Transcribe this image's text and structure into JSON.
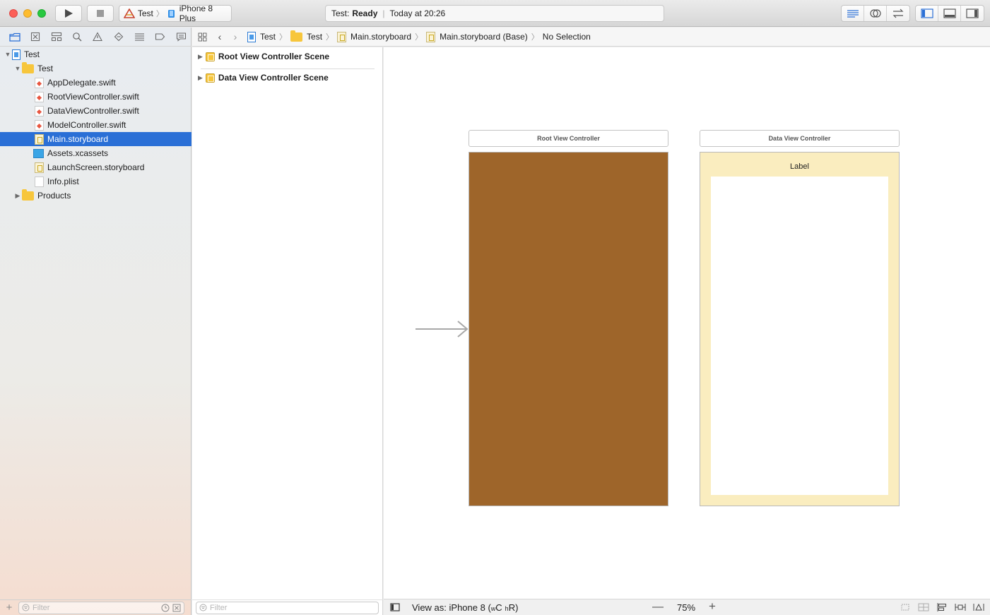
{
  "toolbar": {
    "scheme_target": "Test",
    "scheme_device": "iPhone 8 Plus",
    "status_project": "Test:",
    "status_state": "Ready",
    "status_time": "Today at 20:26"
  },
  "navigator": {
    "tree": [
      {
        "label": "Test",
        "type": "project",
        "level": 0,
        "expanded": true
      },
      {
        "label": "Test",
        "type": "folder",
        "level": 1,
        "expanded": true
      },
      {
        "label": "AppDelegate.swift",
        "type": "swift",
        "level": 2
      },
      {
        "label": "RootViewController.swift",
        "type": "swift",
        "level": 2
      },
      {
        "label": "DataViewController.swift",
        "type": "swift",
        "level": 2
      },
      {
        "label": "ModelController.swift",
        "type": "swift",
        "level": 2
      },
      {
        "label": "Main.storyboard",
        "type": "storyboard",
        "level": 2,
        "selected": true
      },
      {
        "label": "Assets.xcassets",
        "type": "assets",
        "level": 2
      },
      {
        "label": "LaunchScreen.storyboard",
        "type": "storyboard",
        "level": 2
      },
      {
        "label": "Info.plist",
        "type": "plist",
        "level": 2
      },
      {
        "label": "Products",
        "type": "folder",
        "level": 1,
        "expanded": false
      }
    ],
    "filter_placeholder": "Filter"
  },
  "jumpbar": {
    "crumbs": [
      "Test",
      "Test",
      "Main.storyboard",
      "Main.storyboard (Base)",
      "No Selection"
    ]
  },
  "outline": {
    "scenes": [
      "Root View Controller Scene",
      "Data View Controller Scene"
    ],
    "filter_placeholder": "Filter"
  },
  "canvas": {
    "root_vc_title": "Root View Controller",
    "data_vc_title": "Data View Controller",
    "data_label": "Label",
    "root_bg_color": "#9e652a",
    "data_bg_color": "#faedbf"
  },
  "canvas_bar": {
    "view_as_prefix": "View as: iPhone 8 (",
    "size_w": "w",
    "size_w_class": "C",
    "size_h": "h",
    "size_h_class": "R",
    "view_as_suffix": ")",
    "zoom": "75%"
  }
}
